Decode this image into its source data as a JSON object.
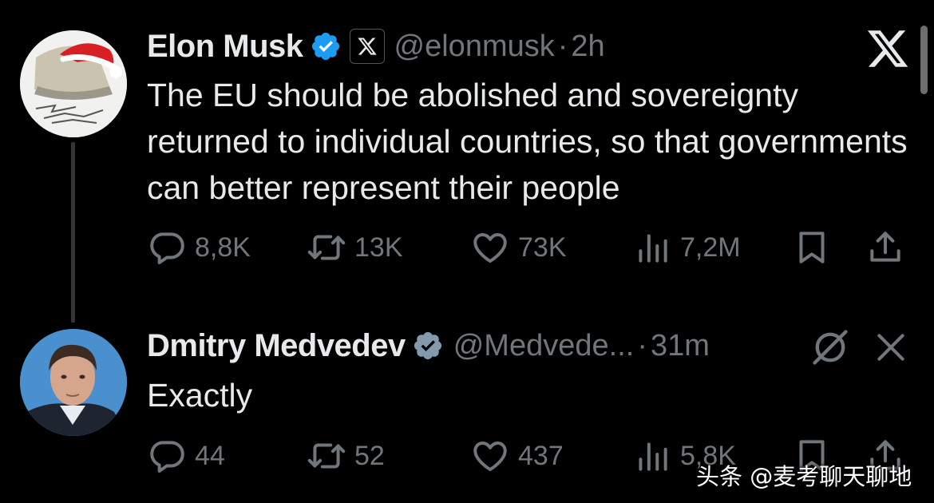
{
  "tweet": {
    "author_name": "Elon Musk",
    "handle": "@elonmusk",
    "separator": "·",
    "time": "2h",
    "text": "The EU should be abolished and sovereignty returned to individual countries, so that governments can better represent their people",
    "stats": {
      "replies": "8,8K",
      "reposts": "13K",
      "likes": "73K",
      "views": "7,2M"
    }
  },
  "reply": {
    "author_name": "Dmitry Medvedev",
    "handle": "@Medvede...",
    "separator": "·",
    "time": "31m",
    "text": "Exactly",
    "stats": {
      "replies": "44",
      "reposts": "52",
      "likes": "437",
      "views": "5,8K"
    }
  },
  "watermark": "头条 @麦考聊天聊地",
  "colors": {
    "background": "#000000",
    "text_primary": "#e7e9ea",
    "text_secondary": "#71767b",
    "verified_blue": "#1d9bf0",
    "verified_gray": "#829aab"
  },
  "icons": {
    "brand": "x-logo-icon",
    "affiliation": "x-affiliate-badge-icon",
    "reply": "speech-bubble-icon",
    "repost": "repost-arrows-icon",
    "like": "heart-icon",
    "views": "bar-chart-icon",
    "bookmark": "bookmark-icon",
    "share": "share-upload-icon",
    "mute": "slashed-circle-icon",
    "close": "close-x-icon"
  }
}
